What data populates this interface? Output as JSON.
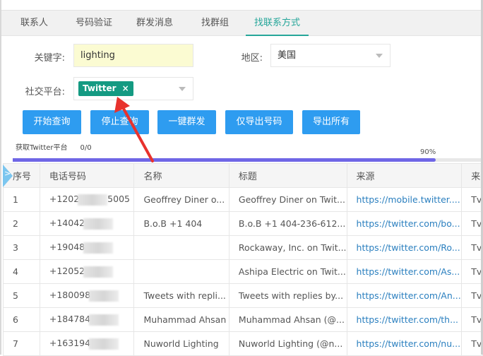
{
  "tabs": [
    {
      "label": "联系人",
      "active": false
    },
    {
      "label": "号码验证",
      "active": false
    },
    {
      "label": "群发消息",
      "active": false
    },
    {
      "label": "找群组",
      "active": false
    },
    {
      "label": "找联系方式",
      "active": true
    }
  ],
  "form": {
    "keyword_label": "关键字:",
    "keyword_value": "lighting",
    "region_label": "地区:",
    "region_value": "美国",
    "platform_label": "社交平台:",
    "platform_tag": "Twitter",
    "platform_tag_remove": "×"
  },
  "buttons": {
    "start": "开始查询",
    "stop": "停止查询",
    "broadcast": "一键群发",
    "export_numbers": "仅导出号码",
    "export_all": "导出所有"
  },
  "status": {
    "text": "获取Twitter平台",
    "count": "0/0",
    "progress_label": "90%",
    "progress_percent": 90
  },
  "colors": {
    "accent_tab": "#26a69a",
    "button": "#2e9cf0",
    "tag": "#149a82",
    "progress": "#6f66e6",
    "link": "#2a7fbf",
    "annotation_arrow": "#e8322d"
  },
  "table": {
    "side_toggle": ">",
    "headers": [
      "序号",
      "电话号码",
      "名称",
      "标题",
      "来源",
      "来"
    ],
    "rows": [
      {
        "index": "1",
        "phone_prefix": "+1202",
        "phone_suffix": "5005",
        "name": "Geoffrey Diner o...",
        "title": "Geoffrey Diner on Twit...",
        "source": "https://mobile.twitter....",
        "extra": "Tv"
      },
      {
        "index": "2",
        "phone_prefix": "+14042",
        "phone_suffix": "",
        "name": "B.o.B +1 404",
        "title": "B.o.B +1 404-236-612...",
        "source": "https://twitter.com/bo...",
        "extra": "Tv"
      },
      {
        "index": "3",
        "phone_prefix": "+19048",
        "phone_suffix": "",
        "name": "",
        "title": "Rockaway, Inc. on Twit...",
        "source": "https://twitter.com/Ro...",
        "extra": "Tv"
      },
      {
        "index": "4",
        "phone_prefix": "+12052",
        "phone_suffix": "",
        "name": "",
        "title": "Ashipa Electric on Twit...",
        "source": "https://twitter.com/As...",
        "extra": "Tv"
      },
      {
        "index": "5",
        "phone_prefix": "+180098",
        "phone_suffix": "",
        "name": "Tweets with repli...",
        "title": "Tweets with replies by...",
        "source": "https://twitter.com/An...",
        "extra": "Tv"
      },
      {
        "index": "6",
        "phone_prefix": "+184784",
        "phone_suffix": "",
        "name": "Muhammad Ahsan",
        "title": "Muhammad Ahsan (@...",
        "source": "https://twitter.com/th...",
        "extra": "Tv"
      },
      {
        "index": "7",
        "phone_prefix": "+163194",
        "phone_suffix": "",
        "name": "Nuworld Lighting",
        "title": "Nuworld Lighting (@n...",
        "source": "https://twitter.com/nu...",
        "extra": "Tv"
      }
    ]
  }
}
